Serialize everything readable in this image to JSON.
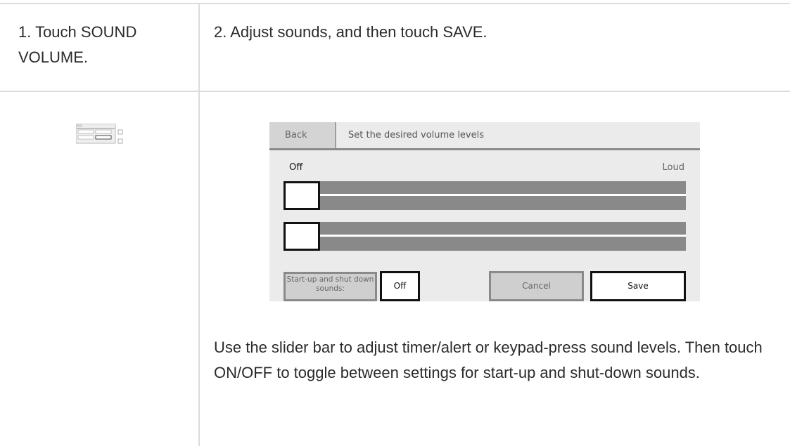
{
  "steps": {
    "step1": {
      "text": "1. Touch SOUND VOLUME."
    },
    "step2": {
      "text": "2. Adjust sounds, and then touch SAVE."
    }
  },
  "thumbnail": {
    "icon": "screen-thumbnail"
  },
  "screen": {
    "back_label": "Back",
    "header": "Set the desired volume levels",
    "min_label": "Off",
    "max_label": "Loud",
    "sliders": [
      {
        "level": 0
      },
      {
        "level": 0
      }
    ],
    "startup_label": "Start-up and shut down sounds:",
    "startup_value": "Off",
    "cancel_label": "Cancel",
    "save_label": "Save"
  },
  "description": "Use the slider bar to adjust timer/alert or keypad-press sound levels. Then touch ON/OFF to toggle between settings for start-up and shut-down sounds."
}
